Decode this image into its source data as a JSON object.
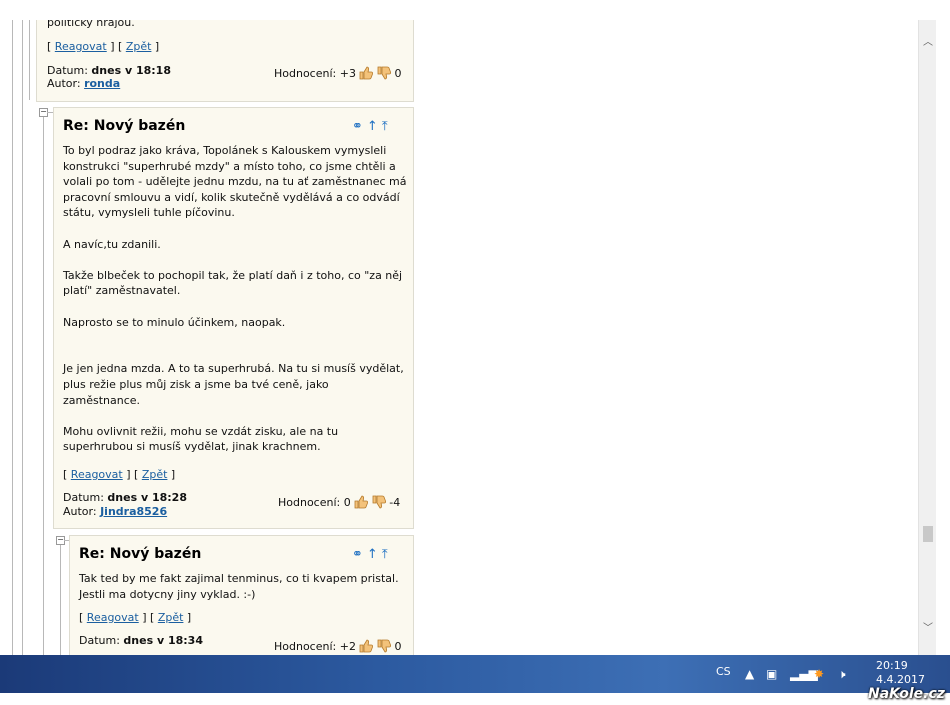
{
  "comments": [
    {
      "top_text": "politicky hrajou.",
      "reply_label": "Reagovat",
      "back_label": "Zpět",
      "date_label": "Datum:",
      "date_value": "dnes v 18:18",
      "author_label": "Autor:",
      "author": "ronda",
      "rating_label": "Hodnocení:",
      "rating_value": "+3",
      "rating_count": "0"
    },
    {
      "title": "Re: Nový bazén",
      "paragraphs": [
        "To byl podraz jako kráva, Topolánek s Kalouskem vymysleli konstrukci \"superhrubé mzdy\" a místo toho, co jsme chtěli a volali po tom - udělejte jednu mzdu, na tu ať zaměstnanec má pracovní smlouvu a vidí, kolik skutečně vydělává a co odvádí státu, vymysleli tuhle píčovinu.",
        "A navíc,tu zdanili.",
        "Takže blbeček to pochopil tak, že platí daň i z toho, co \"za něj platí\" zaměstnavatel.",
        "Naprosto se to minulo účinkem, naopak.",
        "Je jen jedna mzda. A to ta superhrubá. Na tu si musíš vydělat, plus režie plus můj zisk a jsme ba tvé ceně, jako zaměstnance.",
        "Mohu ovlivnit režii, mohu se vzdát zisku, ale na tu superhrubou si musíš vydělat, jinak krachnem."
      ],
      "reply_label": "Reagovat",
      "back_label": "Zpět",
      "date_label": "Datum:",
      "date_value": "dnes v 18:28",
      "author_label": "Autor:",
      "author": "Jindra8526",
      "rating_label": "Hodnocení:",
      "rating_value": "0",
      "rating_count": "-4"
    },
    {
      "title": "Re: Nový bazén",
      "paragraphs": [
        "Tak ted by me fakt zajimal tenminus, co ti kvapem pristal. Jestli ma dotycny jiny vyklad. :-)"
      ],
      "reply_label": "Reagovat",
      "back_label": "Zpět",
      "date_label": "Datum:",
      "date_value": "dnes v 18:34",
      "rating_label": "Hodnocení:",
      "rating_value": "+2",
      "rating_count": "0"
    }
  ],
  "taskbar": {
    "lang": "CS",
    "time": "20:19",
    "date": "4.4.2017"
  },
  "watermark": "NaKole.cz"
}
